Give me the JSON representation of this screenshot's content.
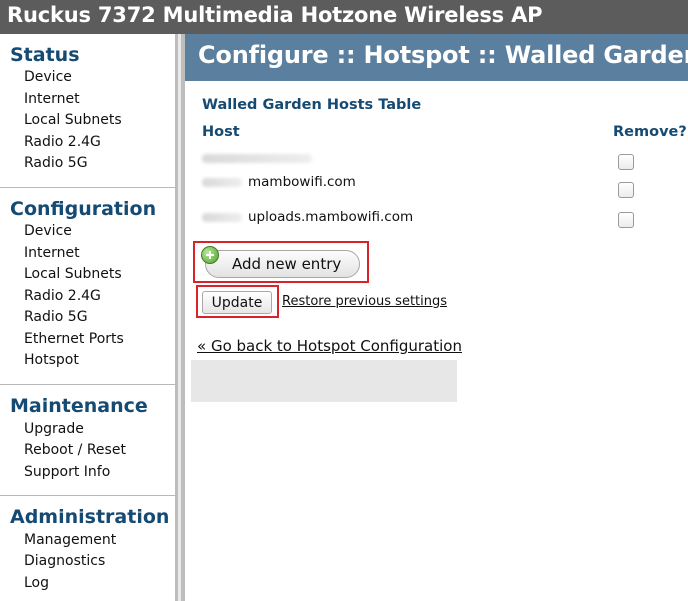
{
  "app": {
    "title": "Ruckus 7372 Multimedia Hotzone Wireless AP"
  },
  "sidebar": {
    "status": {
      "title": "Status",
      "items": [
        "Device",
        "Internet",
        "Local Subnets",
        "Radio 2.4G",
        "Radio 5G"
      ]
    },
    "configuration": {
      "title": "Configuration",
      "items": [
        "Device",
        "Internet",
        "Local Subnets",
        "Radio 2.4G",
        "Radio 5G",
        "Ethernet Ports",
        "Hotspot"
      ]
    },
    "maintenance": {
      "title": "Maintenance",
      "items": [
        "Upgrade",
        "Reboot / Reset",
        "Support Info"
      ]
    },
    "administration": {
      "title": "Administration",
      "items": [
        "Management",
        "Diagnostics",
        "Log"
      ]
    }
  },
  "main": {
    "title": "Configure :: Hotspot :: Walled Garden",
    "table": {
      "title": "Walled Garden Hosts Table",
      "col_host": "Host",
      "col_remove": "Remove?",
      "rows": [
        {
          "host": ""
        },
        {
          "host": "mambowifi.com"
        },
        {
          "host": "uploads.mambowifi.com"
        }
      ]
    },
    "add_entry_label": "Add new entry",
    "update_label": "Update",
    "restore_label": "Restore previous settings",
    "back_link": "« Go back to Hotspot Configuration"
  },
  "colors": {
    "topbar": "#5c5c5c",
    "header": "#5b7f9e",
    "section_title": "#154a73",
    "highlight": "#d8232a"
  }
}
